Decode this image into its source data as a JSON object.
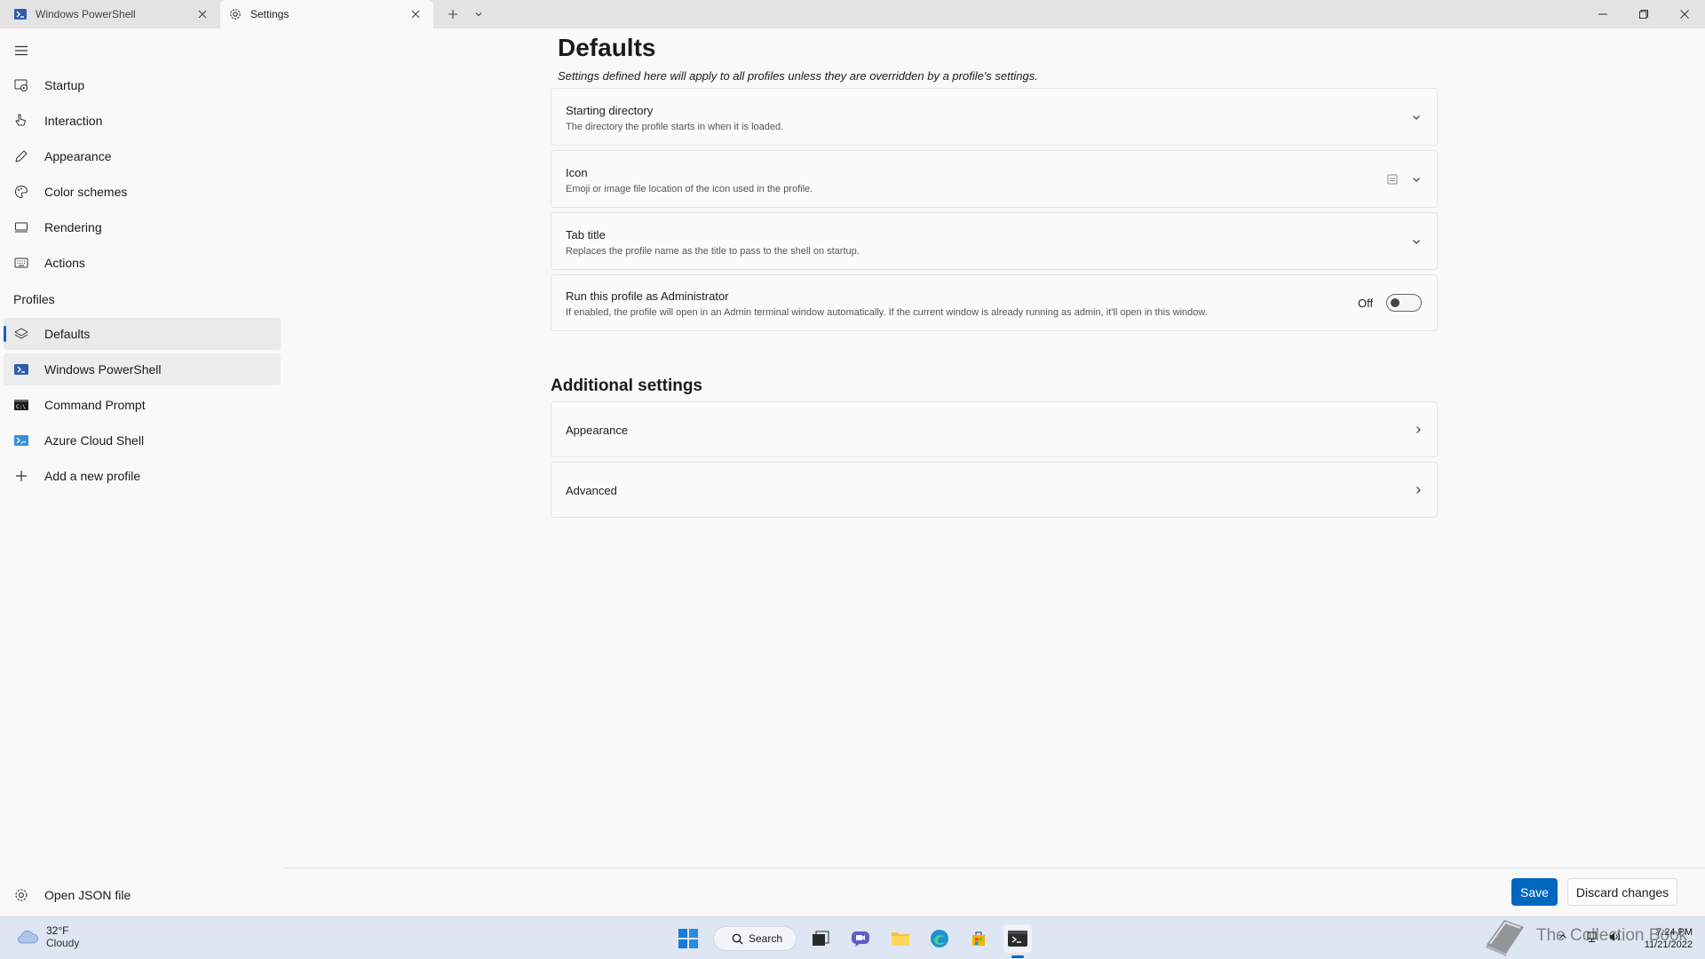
{
  "titlebar": {
    "tabs": [
      {
        "label": "Windows PowerShell",
        "icon": "powershell-icon"
      },
      {
        "label": "Settings",
        "icon": "gear-icon"
      }
    ]
  },
  "sidebar": {
    "items": [
      {
        "label": "Startup",
        "icon": "startup-icon"
      },
      {
        "label": "Interaction",
        "icon": "interaction-icon"
      },
      {
        "label": "Appearance",
        "icon": "pen-icon"
      },
      {
        "label": "Color schemes",
        "icon": "palette-icon"
      },
      {
        "label": "Rendering",
        "icon": "monitor-icon"
      },
      {
        "label": "Actions",
        "icon": "keyboard-icon"
      }
    ],
    "profiles_header": "Profiles",
    "profiles": [
      {
        "label": "Defaults",
        "icon": "layers-icon",
        "selected": true
      },
      {
        "label": "Windows PowerShell",
        "icon": "powershell-icon"
      },
      {
        "label": "Command Prompt",
        "icon": "cmd-icon"
      },
      {
        "label": "Azure Cloud Shell",
        "icon": "azure-icon"
      },
      {
        "label": "Add a new profile",
        "icon": "plus-icon"
      }
    ],
    "open_json": "Open JSON file"
  },
  "main": {
    "title": "Defaults",
    "subtitle": "Settings defined here will apply to all profiles unless they are overridden by a profile's settings.",
    "settings": [
      {
        "title": "Starting directory",
        "desc": "The directory the profile starts in when it is loaded."
      },
      {
        "title": "Icon",
        "desc": "Emoji or image file location of the icon used in the profile."
      },
      {
        "title": "Tab title",
        "desc": "Replaces the profile name as the title to pass to the shell on startup."
      },
      {
        "title": "Run this profile as Administrator",
        "desc": "If enabled, the profile will open in an Admin terminal window automatically. If the current window is already running as admin, it'll open in this window.",
        "toggle_label": "Off"
      }
    ],
    "additional_title": "Additional settings",
    "additional": [
      {
        "title": "Appearance"
      },
      {
        "title": "Advanced"
      }
    ]
  },
  "footer": {
    "save_label": "Save",
    "discard_label": "Discard changes"
  },
  "taskbar": {
    "weather_temp": "32°F",
    "weather_cond": "Cloudy",
    "search_label": "Search",
    "time": "7:24 PM",
    "date": "11/21/2022",
    "watermark": "The Collection Book"
  },
  "colors": {
    "accent": "#0067c0",
    "background": "#f9f9f9",
    "titlebar": "#e3e3e3",
    "taskbar": "#dde6f2"
  }
}
